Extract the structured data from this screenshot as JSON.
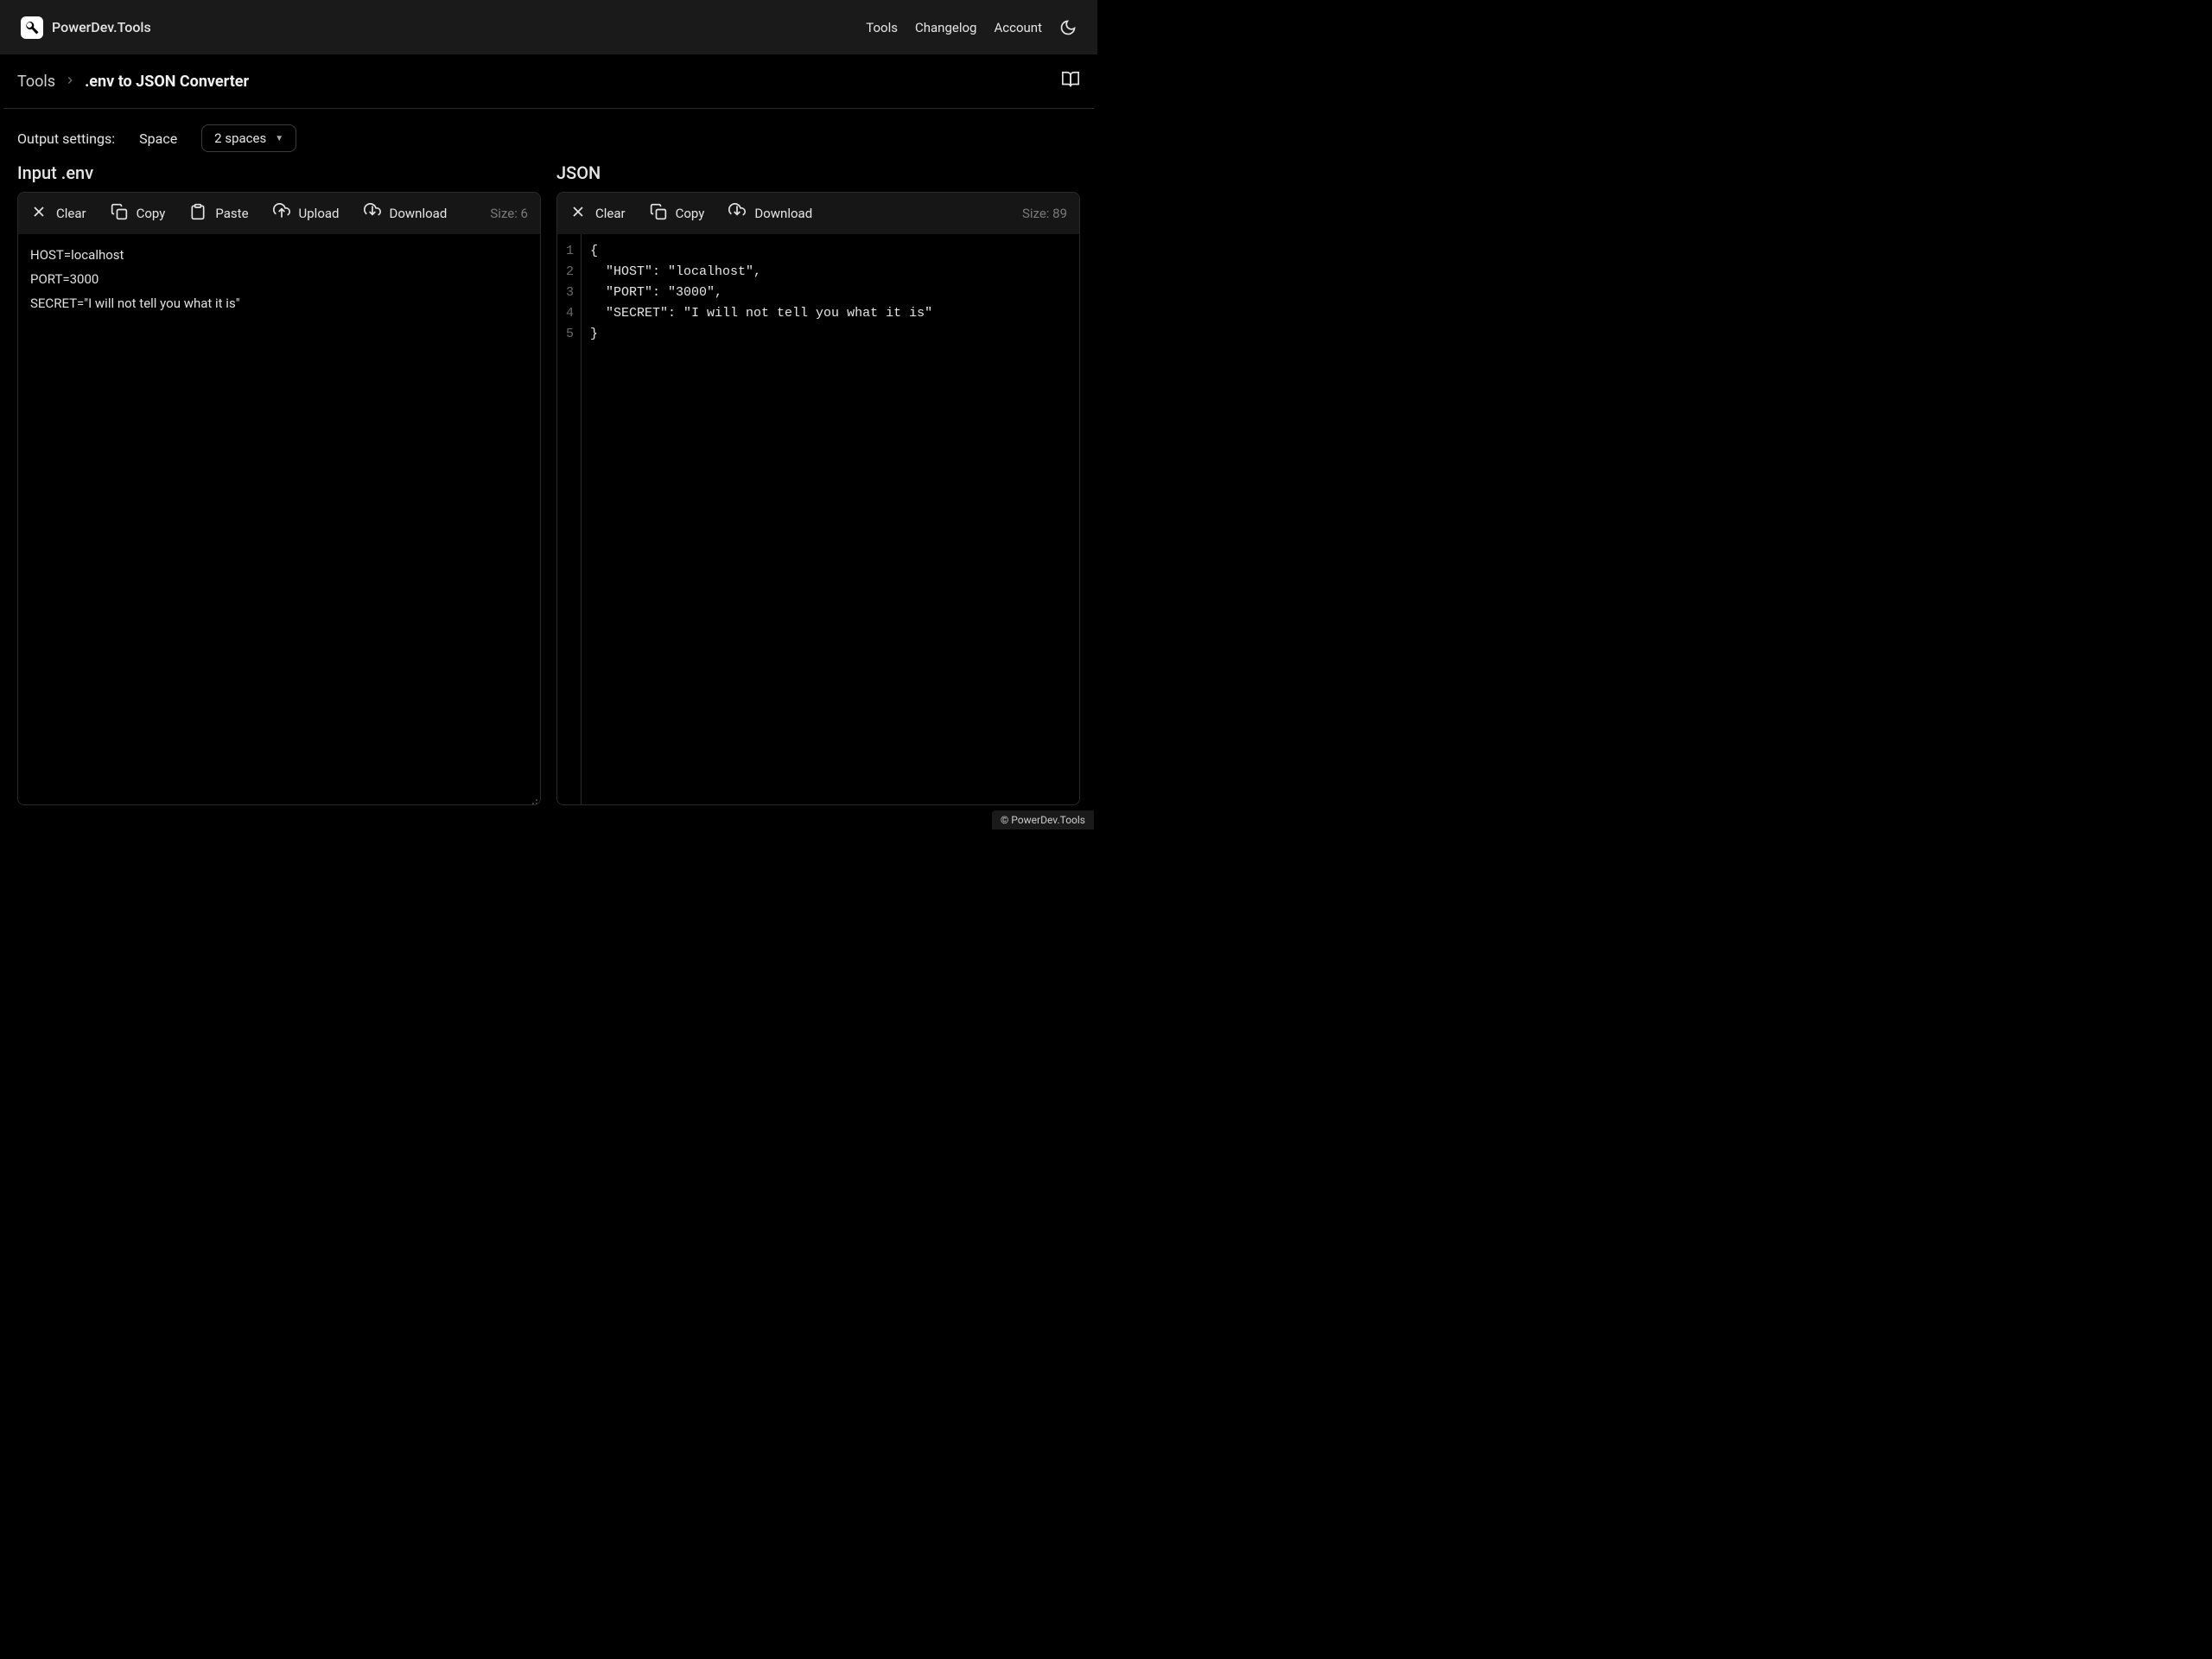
{
  "brand": "PowerDev.Tools",
  "nav": {
    "tools": "Tools",
    "changelog": "Changelog",
    "account": "Account"
  },
  "breadcrumb": {
    "root": "Tools",
    "current": ".env to JSON Converter"
  },
  "settings": {
    "label": "Output settings:",
    "space_label": "Space",
    "space_value": "2 spaces"
  },
  "input": {
    "title": "Input .env",
    "toolbar": {
      "clear": "Clear",
      "copy": "Copy",
      "paste": "Paste",
      "upload": "Upload",
      "download": "Download",
      "size": "Size: 6"
    },
    "content": "HOST=localhost\nPORT=3000\nSECRET=\"I will not tell you what it is\""
  },
  "output": {
    "title": "JSON",
    "toolbar": {
      "clear": "Clear",
      "copy": "Copy",
      "download": "Download",
      "size": "Size: 89"
    },
    "lines": [
      "{",
      "  \"HOST\": \"localhost\",",
      "  \"PORT\": \"3000\",",
      "  \"SECRET\": \"I will not tell you what it is\"",
      "}"
    ]
  },
  "footer": "© PowerDev.Tools"
}
